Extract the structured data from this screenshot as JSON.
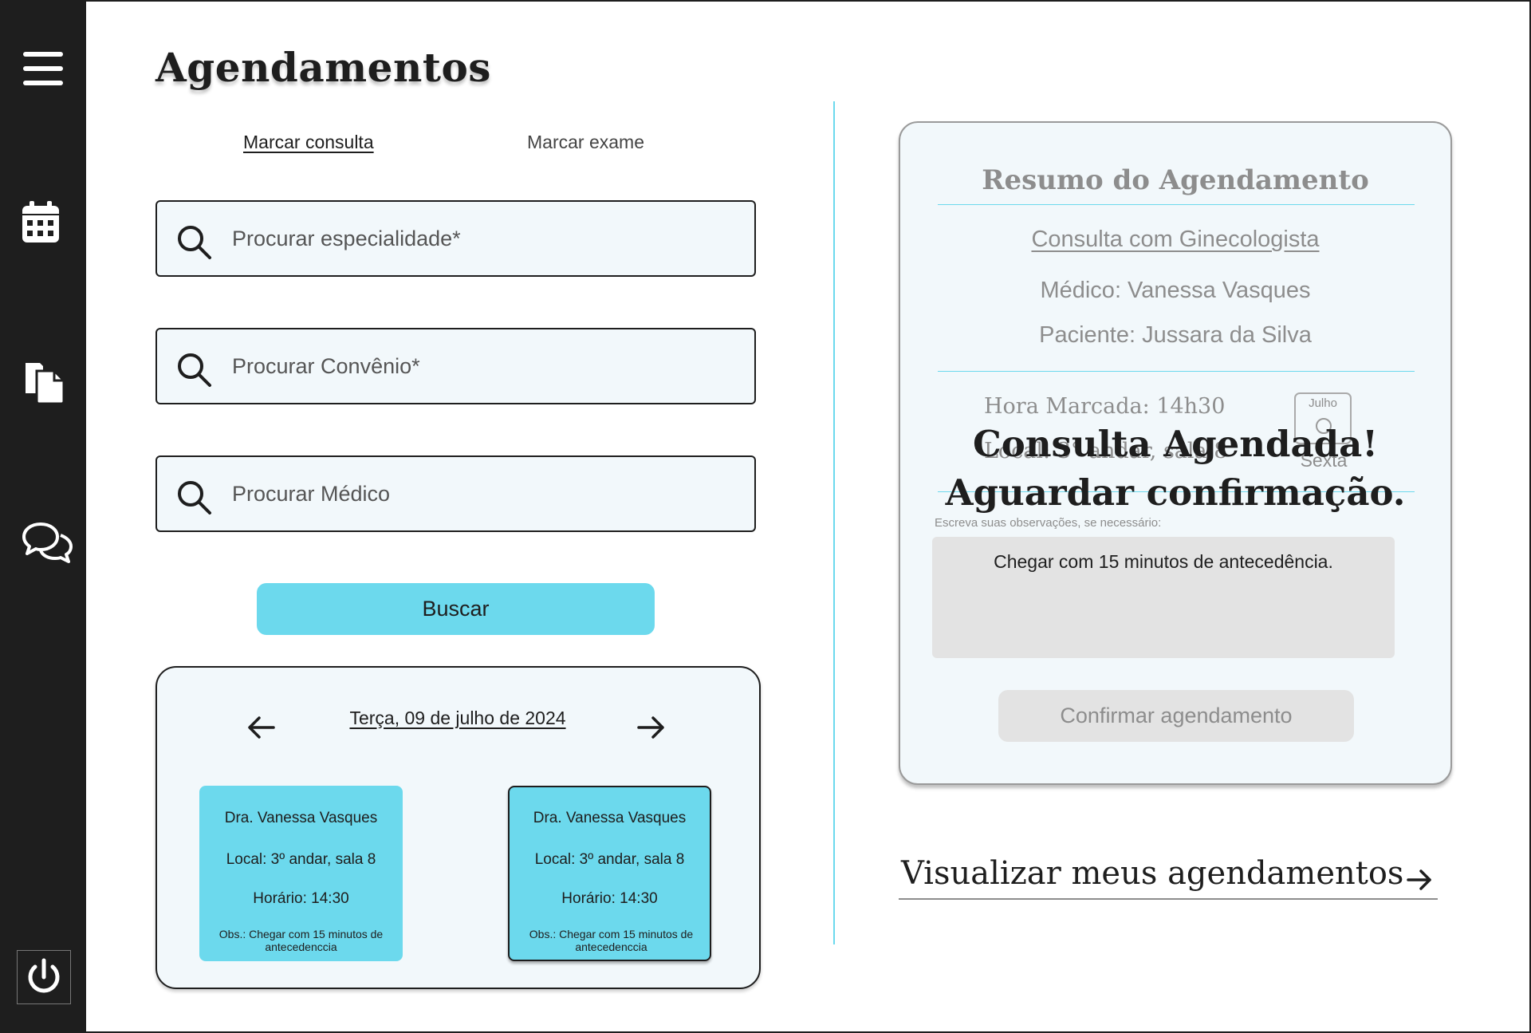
{
  "page": {
    "title": "Agendamentos"
  },
  "sidebar": {
    "items": [
      {
        "name": "menu",
        "icon": "hamburger-menu-icon"
      },
      {
        "name": "calendar",
        "icon": "calendar-icon"
      },
      {
        "name": "documents",
        "icon": "documents-icon"
      },
      {
        "name": "chat",
        "icon": "chat-icon"
      },
      {
        "name": "logout",
        "icon": "power-icon"
      }
    ]
  },
  "tabs": [
    {
      "label": "Marcar consulta",
      "active": true
    },
    {
      "label": "Marcar exame",
      "active": false
    }
  ],
  "search": {
    "specialty_placeholder": "Procurar especialidade*",
    "insurance_placeholder": "Procurar Convênio*",
    "doctor_placeholder": "Procurar Médico",
    "button_label": "Buscar"
  },
  "calendar": {
    "date_label": "Terça, 09 de julho de 2024",
    "slots": [
      {
        "doctor": "Dra. Vanessa Vasques",
        "location": "Local: 3º andar, sala 8",
        "time": "Horário: 14:30",
        "obs": "Obs.: Chegar com 15 minutos de antecedenccia",
        "selected": false
      },
      {
        "doctor": "Dra. Vanessa Vasques",
        "location": "Local: 3º andar, sala 8",
        "time": "Horário: 14:30",
        "obs": "Obs.: Chegar com 15 minutos de antecedenccia",
        "selected": true
      }
    ]
  },
  "summary": {
    "title": "Resumo do Agendamento",
    "specialty": "Consulta com Ginecologista",
    "doctor": "Médico: Vanessa Vasques",
    "patient": "Paciente: Jussara da Silva",
    "time": "Hora Marcada: 14h30",
    "location": "Local: 3° andar, sala 8",
    "month": "Julho",
    "weekday": "Sexta",
    "overlay_line1": "Consulta Agendada!",
    "overlay_line2": "Aguardar confirmação.",
    "obs_label": "Escreva suas observações, se necessário:",
    "obs_value": "Chegar com 15 minutos de antecedência.",
    "confirm_label": "Confirmar agendamento"
  },
  "view_link": {
    "label": "Visualizar meus agendamentos"
  },
  "colors": {
    "accent": "#6cd9ed",
    "sidebar": "#1e1e1e",
    "panel": "#f2f8fb",
    "muted": "#8d8d8d"
  }
}
